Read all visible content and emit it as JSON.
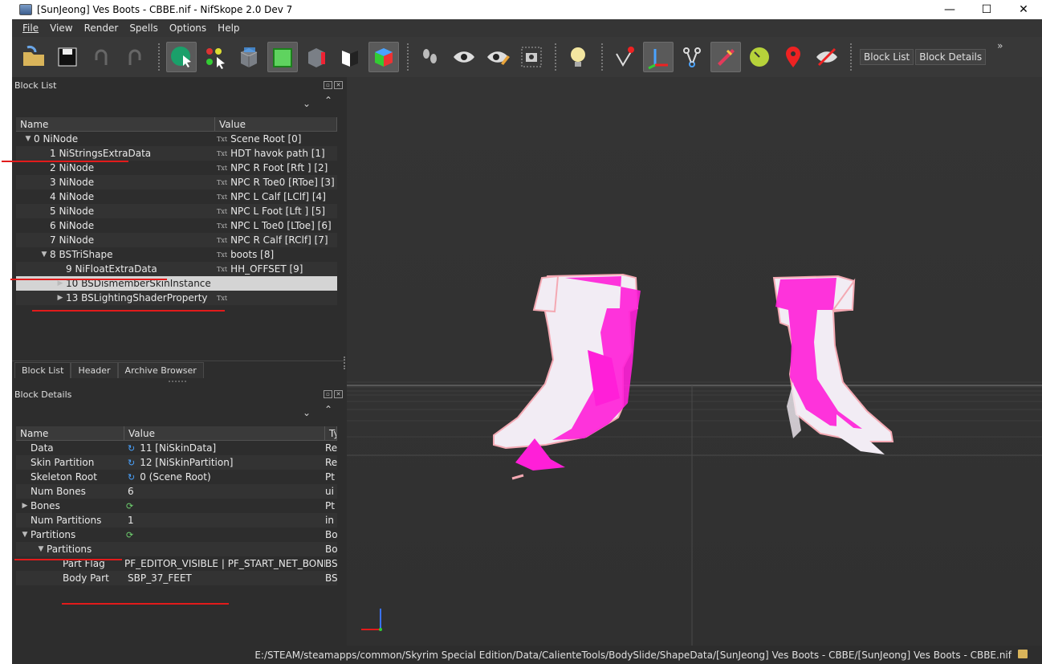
{
  "window": {
    "title": "[SunJeong] Ves Boots - CBBE.nif - NifSkope 2.0 Dev 7",
    "min": "—",
    "max": "☐",
    "close": "✕"
  },
  "menu": [
    "File",
    "View",
    "Render",
    "Spells",
    "Options",
    "Help"
  ],
  "toolbar": {
    "block_list_label": "Block List",
    "block_details_label": "Block Details",
    "more": "»"
  },
  "block_list": {
    "title": "Block List",
    "col_name": "Name",
    "col_value": "Value",
    "rows": [
      {
        "name": "0 NiNode",
        "value": "Scene Root [0]",
        "arrow": "▼",
        "txt": "Txt"
      },
      {
        "name": "1 NiStringsExtraData",
        "value": "HDT havok path [1]",
        "arrow": "",
        "txt": "Txt"
      },
      {
        "name": "2 NiNode",
        "value": "NPC R Foot [Rft ] [2]",
        "arrow": "",
        "txt": "Txt"
      },
      {
        "name": "3 NiNode",
        "value": "NPC R Toe0 [RToe] [3]",
        "arrow": "",
        "txt": "Txt"
      },
      {
        "name": "4 NiNode",
        "value": "NPC L Calf [LClf] [4]",
        "arrow": "",
        "txt": "Txt"
      },
      {
        "name": "5 NiNode",
        "value": "NPC L Foot [Lft ] [5]",
        "arrow": "",
        "txt": "Txt"
      },
      {
        "name": "6 NiNode",
        "value": "NPC L Toe0 [LToe] [6]",
        "arrow": "",
        "txt": "Txt"
      },
      {
        "name": "7 NiNode",
        "value": "NPC R Calf [RClf] [7]",
        "arrow": "",
        "txt": "Txt"
      },
      {
        "name": "8 BSTriShape",
        "value": "boots [8]",
        "arrow": "▼",
        "txt": "Txt"
      },
      {
        "name": "9 NiFloatExtraData",
        "value": "HH_OFFSET [9]",
        "arrow": "",
        "txt": "Txt"
      },
      {
        "name": "10 BSDismemberSkinInstance",
        "value": "",
        "arrow": "▶",
        "txt": ""
      },
      {
        "name": "13 BSLightingShaderProperty",
        "value": "",
        "arrow": "▶",
        "txt": "Txt"
      }
    ]
  },
  "tabs": [
    "Block List",
    "Header",
    "Archive Browser"
  ],
  "block_details": {
    "title": "Block Details",
    "col_name": "Name",
    "col_value": "Value",
    "col_type": "Ty",
    "rows": [
      {
        "name": "Data",
        "icon": "link",
        "value": "11 [NiSkinData]",
        "type": "Re",
        "arrow": ""
      },
      {
        "name": "Skin Partition",
        "icon": "link",
        "value": "12 [NiSkinPartition]",
        "type": "Re",
        "arrow": ""
      },
      {
        "name": "Skeleton Root",
        "icon": "link",
        "value": "0 (Scene Root)",
        "type": "Pt",
        "arrow": ""
      },
      {
        "name": "Num Bones",
        "icon": "",
        "value": "6",
        "type": "ui",
        "arrow": ""
      },
      {
        "name": "Bones",
        "icon": "cycle",
        "value": "",
        "type": "Pt",
        "arrow": "▶"
      },
      {
        "name": "Num Partitions",
        "icon": "",
        "value": "1",
        "type": "in",
        "arrow": ""
      },
      {
        "name": "Partitions",
        "icon": "cycle",
        "value": "",
        "type": "Bo",
        "arrow": "▼"
      },
      {
        "name": "Partitions",
        "icon": "",
        "value": "",
        "type": "Bo",
        "arrow": "▼"
      },
      {
        "name": "Part Flag",
        "icon": "",
        "value": "PF_EDITOR_VISIBLE | PF_START_NET_BONESET",
        "type": "BS",
        "arrow": ""
      },
      {
        "name": "Body Part",
        "icon": "",
        "value": "SBP_37_FEET",
        "type": "BS",
        "arrow": ""
      }
    ]
  },
  "status": {
    "path": "E:/STEAM/steamapps/common/Skyrim Special Edition/Data/CalienteTools/BodySlide/ShapeData/[SunJeong] Ves Boots - CBBE/[SunJeong] Ves Boots - CBBE.nif"
  },
  "colors": {
    "annotation": "#e21b1b",
    "boot_pink": "#ff1fd8",
    "boot_white": "#f2ecf4",
    "boot_peach": "#f4a9b3"
  }
}
